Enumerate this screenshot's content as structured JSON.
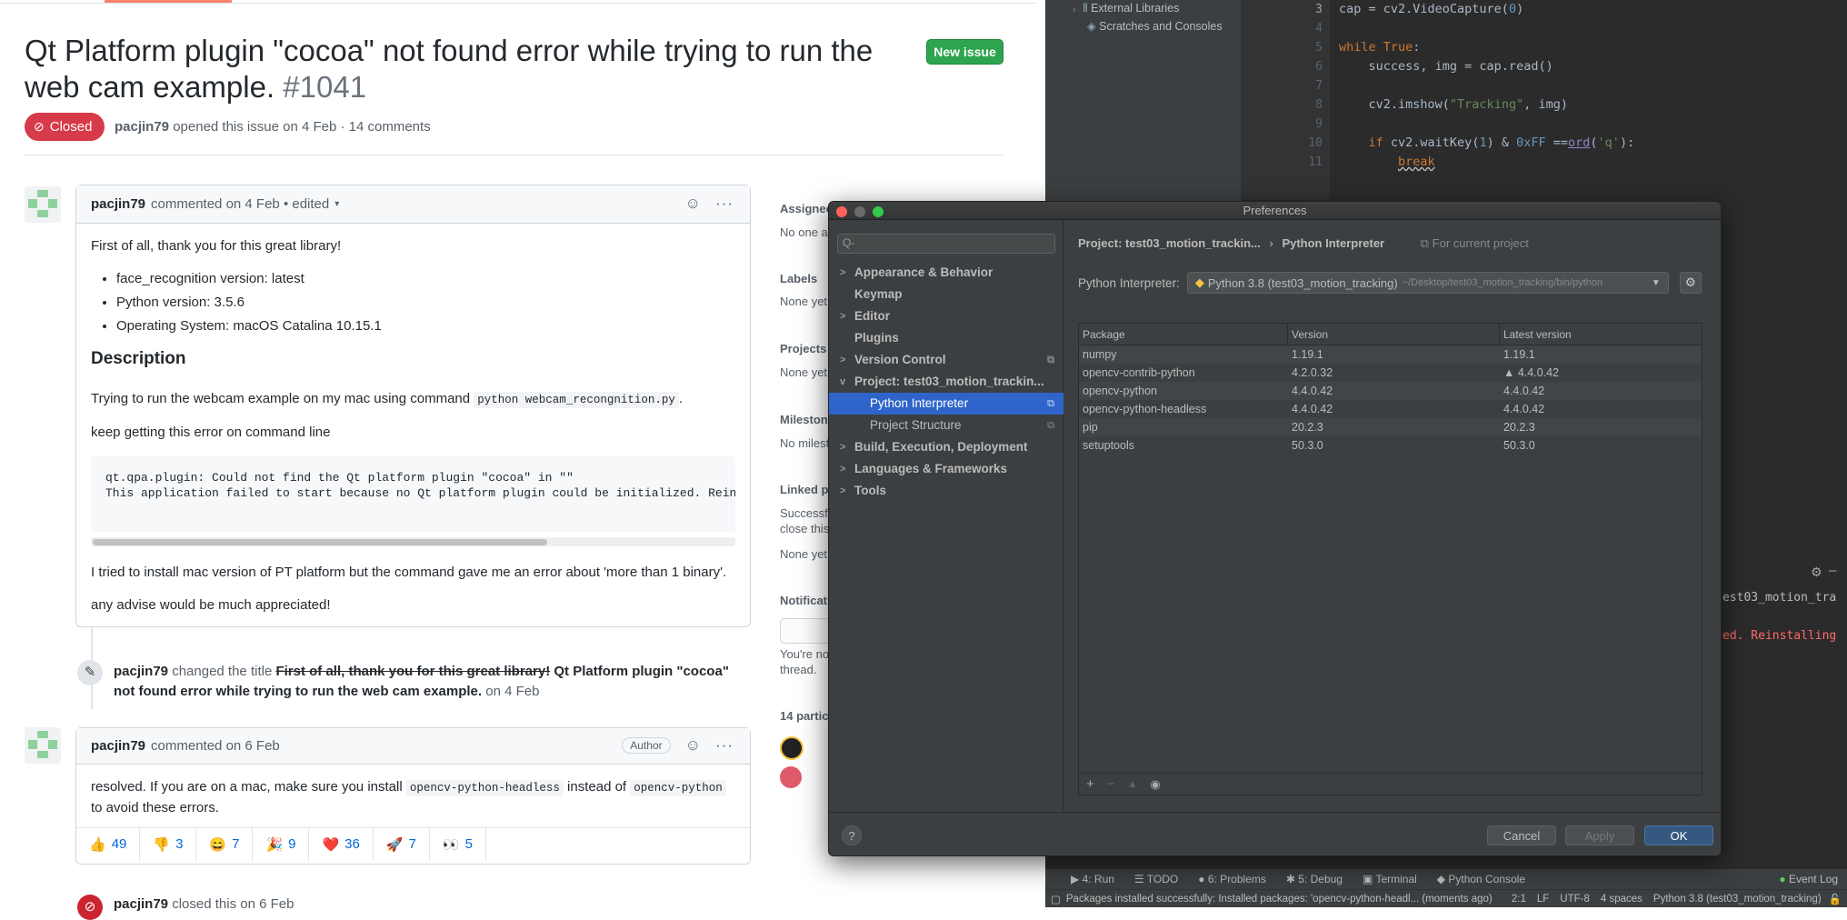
{
  "github": {
    "issue_title": "Qt Platform plugin \"cocoa\" not found error while trying to run the web cam example.",
    "issue_number": "#1041",
    "new_issue_label": "New issue",
    "state_label": "Closed",
    "meta_author": "pacjin79",
    "meta_text": "opened this issue on 4 Feb · 14 comments",
    "comment1": {
      "author": "pacjin79",
      "when": "commented on 4 Feb • edited",
      "intro": "First of all, thank you for this great library!",
      "bullets": [
        "face_recognition version: latest",
        "Python version: 3.5.6",
        "Operating System: macOS Catalina 10.15.1"
      ],
      "heading": "Description",
      "p1_before": "Trying to run the webcam example on my mac using command",
      "p1_code": "python webcam_recongnition.py",
      "p1_after": ".",
      "p2": "keep getting this error on command line",
      "code_block": "qt.qpa.plugin: Could not find the Qt platform plugin \"cocoa\" in \"\"\nThis application failed to start because no Qt platform plugin could be initialized. Reinstalling",
      "p3": "I tried to install mac version of PT platform but the command gave me an error about 'more than 1 binary'.",
      "p4": "any advise would be much appreciated!"
    },
    "rename_event": {
      "author": "pacjin79",
      "action": "changed the title",
      "old_title": "First of all, thank you for this great library!",
      "new_title": "Qt Platform plugin \"cocoa\" not found error while trying to run the web cam example.",
      "when": "on 4 Feb"
    },
    "comment2": {
      "author": "pacjin79",
      "when": "commented on 6 Feb",
      "badge": "Author",
      "p_before": "resolved. If you are on a mac, make sure you install",
      "code1": "opencv-python-headless",
      "p_mid": "instead of",
      "code2": "opencv-python",
      "p_after": "to avoid these errors.",
      "reactions": [
        {
          "emoji": "👍",
          "count": "49"
        },
        {
          "emoji": "👎",
          "count": "3"
        },
        {
          "emoji": "😄",
          "count": "7"
        },
        {
          "emoji": "🎉",
          "count": "9"
        },
        {
          "emoji": "❤️",
          "count": "36"
        },
        {
          "emoji": "🚀",
          "count": "7"
        },
        {
          "emoji": "👀",
          "count": "5"
        }
      ]
    },
    "closed_event": {
      "author": "pacjin79",
      "text": "closed this on 6 Feb"
    },
    "sidebar": {
      "assignees_label": "Assignee",
      "assignees_val": "No one as",
      "labels_label": "Labels",
      "labels_val": "None yet",
      "projects_label": "Projects",
      "projects_val": "None yet",
      "milestone_label": "Milestone",
      "milestone_val": "No milest",
      "linked_label": "Linked pu",
      "linked_val1": "Successf",
      "linked_val2": "close this",
      "linked_val3": "None yet",
      "notif_label": "Notificati",
      "notif_val1": "You're no",
      "notif_val2": "thread.",
      "participants_label": "14 partic"
    }
  },
  "ide": {
    "project_items": [
      "External Libraries",
      "Scratches and Consoles"
    ],
    "line_numbers": [
      "3",
      "4",
      "5",
      "6",
      "7",
      "8",
      "9",
      "10",
      "11"
    ],
    "err_text1": "est03_motion_tra",
    "err_text2": "ed. Reinstalling",
    "bottom_tabs": [
      "4: Run",
      "TODO",
      "6: Problems",
      "5: Debug",
      "Terminal",
      "Python Console"
    ],
    "event_log": "Event Log",
    "status_msg": "Packages installed successfully: Installed packages: 'opencv-python-headl... (moments ago)",
    "status_pos": "2:1",
    "status_lf": "LF",
    "status_enc": "UTF-8",
    "status_indent": "4 spaces",
    "status_interp": "Python 3.8 (test03_motion_tracking)"
  },
  "prefs": {
    "title": "Preferences",
    "search_placeholder": "Q-",
    "tree": [
      {
        "label": "Appearance & Behavior",
        "arrow": ">"
      },
      {
        "label": "Keymap",
        "arrow": ""
      },
      {
        "label": "Editor",
        "arrow": ">"
      },
      {
        "label": "Plugins",
        "arrow": ""
      },
      {
        "label": "Version Control",
        "arrow": ">"
      },
      {
        "label": "Project: test03_motion_trackin...",
        "arrow": "v"
      },
      {
        "label": "Python Interpreter",
        "arrow": ""
      },
      {
        "label": "Project Structure",
        "arrow": ""
      },
      {
        "label": "Build, Execution, Deployment",
        "arrow": ">"
      },
      {
        "label": "Languages & Frameworks",
        "arrow": ">"
      },
      {
        "label": "Tools",
        "arrow": ">"
      }
    ],
    "crumb_project": "Project: test03_motion_trackin...",
    "crumb_sep": "›",
    "crumb_page": "Python Interpreter",
    "crumb_scope": "For current project",
    "interp_label": "Python Interpreter:",
    "interp_value": "Python 3.8 (test03_motion_tracking)",
    "interp_path": "~/Desktop/test03_motion_tracking/bin/python",
    "columns": [
      "Package",
      "Version",
      "Latest version"
    ],
    "packages": [
      {
        "name": "numpy",
        "version": "1.19.1",
        "latest": "1.19.1"
      },
      {
        "name": "opencv-contrib-python",
        "version": "4.2.0.32",
        "latest": "▲ 4.4.0.42"
      },
      {
        "name": "opencv-python",
        "version": "4.4.0.42",
        "latest": "4.4.0.42"
      },
      {
        "name": "opencv-python-headless",
        "version": "4.4.0.42",
        "latest": "4.4.0.42"
      },
      {
        "name": "pip",
        "version": "20.2.3",
        "latest": "20.2.3"
      },
      {
        "name": "setuptools",
        "version": "50.3.0",
        "latest": "50.3.0"
      }
    ],
    "cancel": "Cancel",
    "apply": "Apply",
    "ok": "OK",
    "help": "?"
  }
}
